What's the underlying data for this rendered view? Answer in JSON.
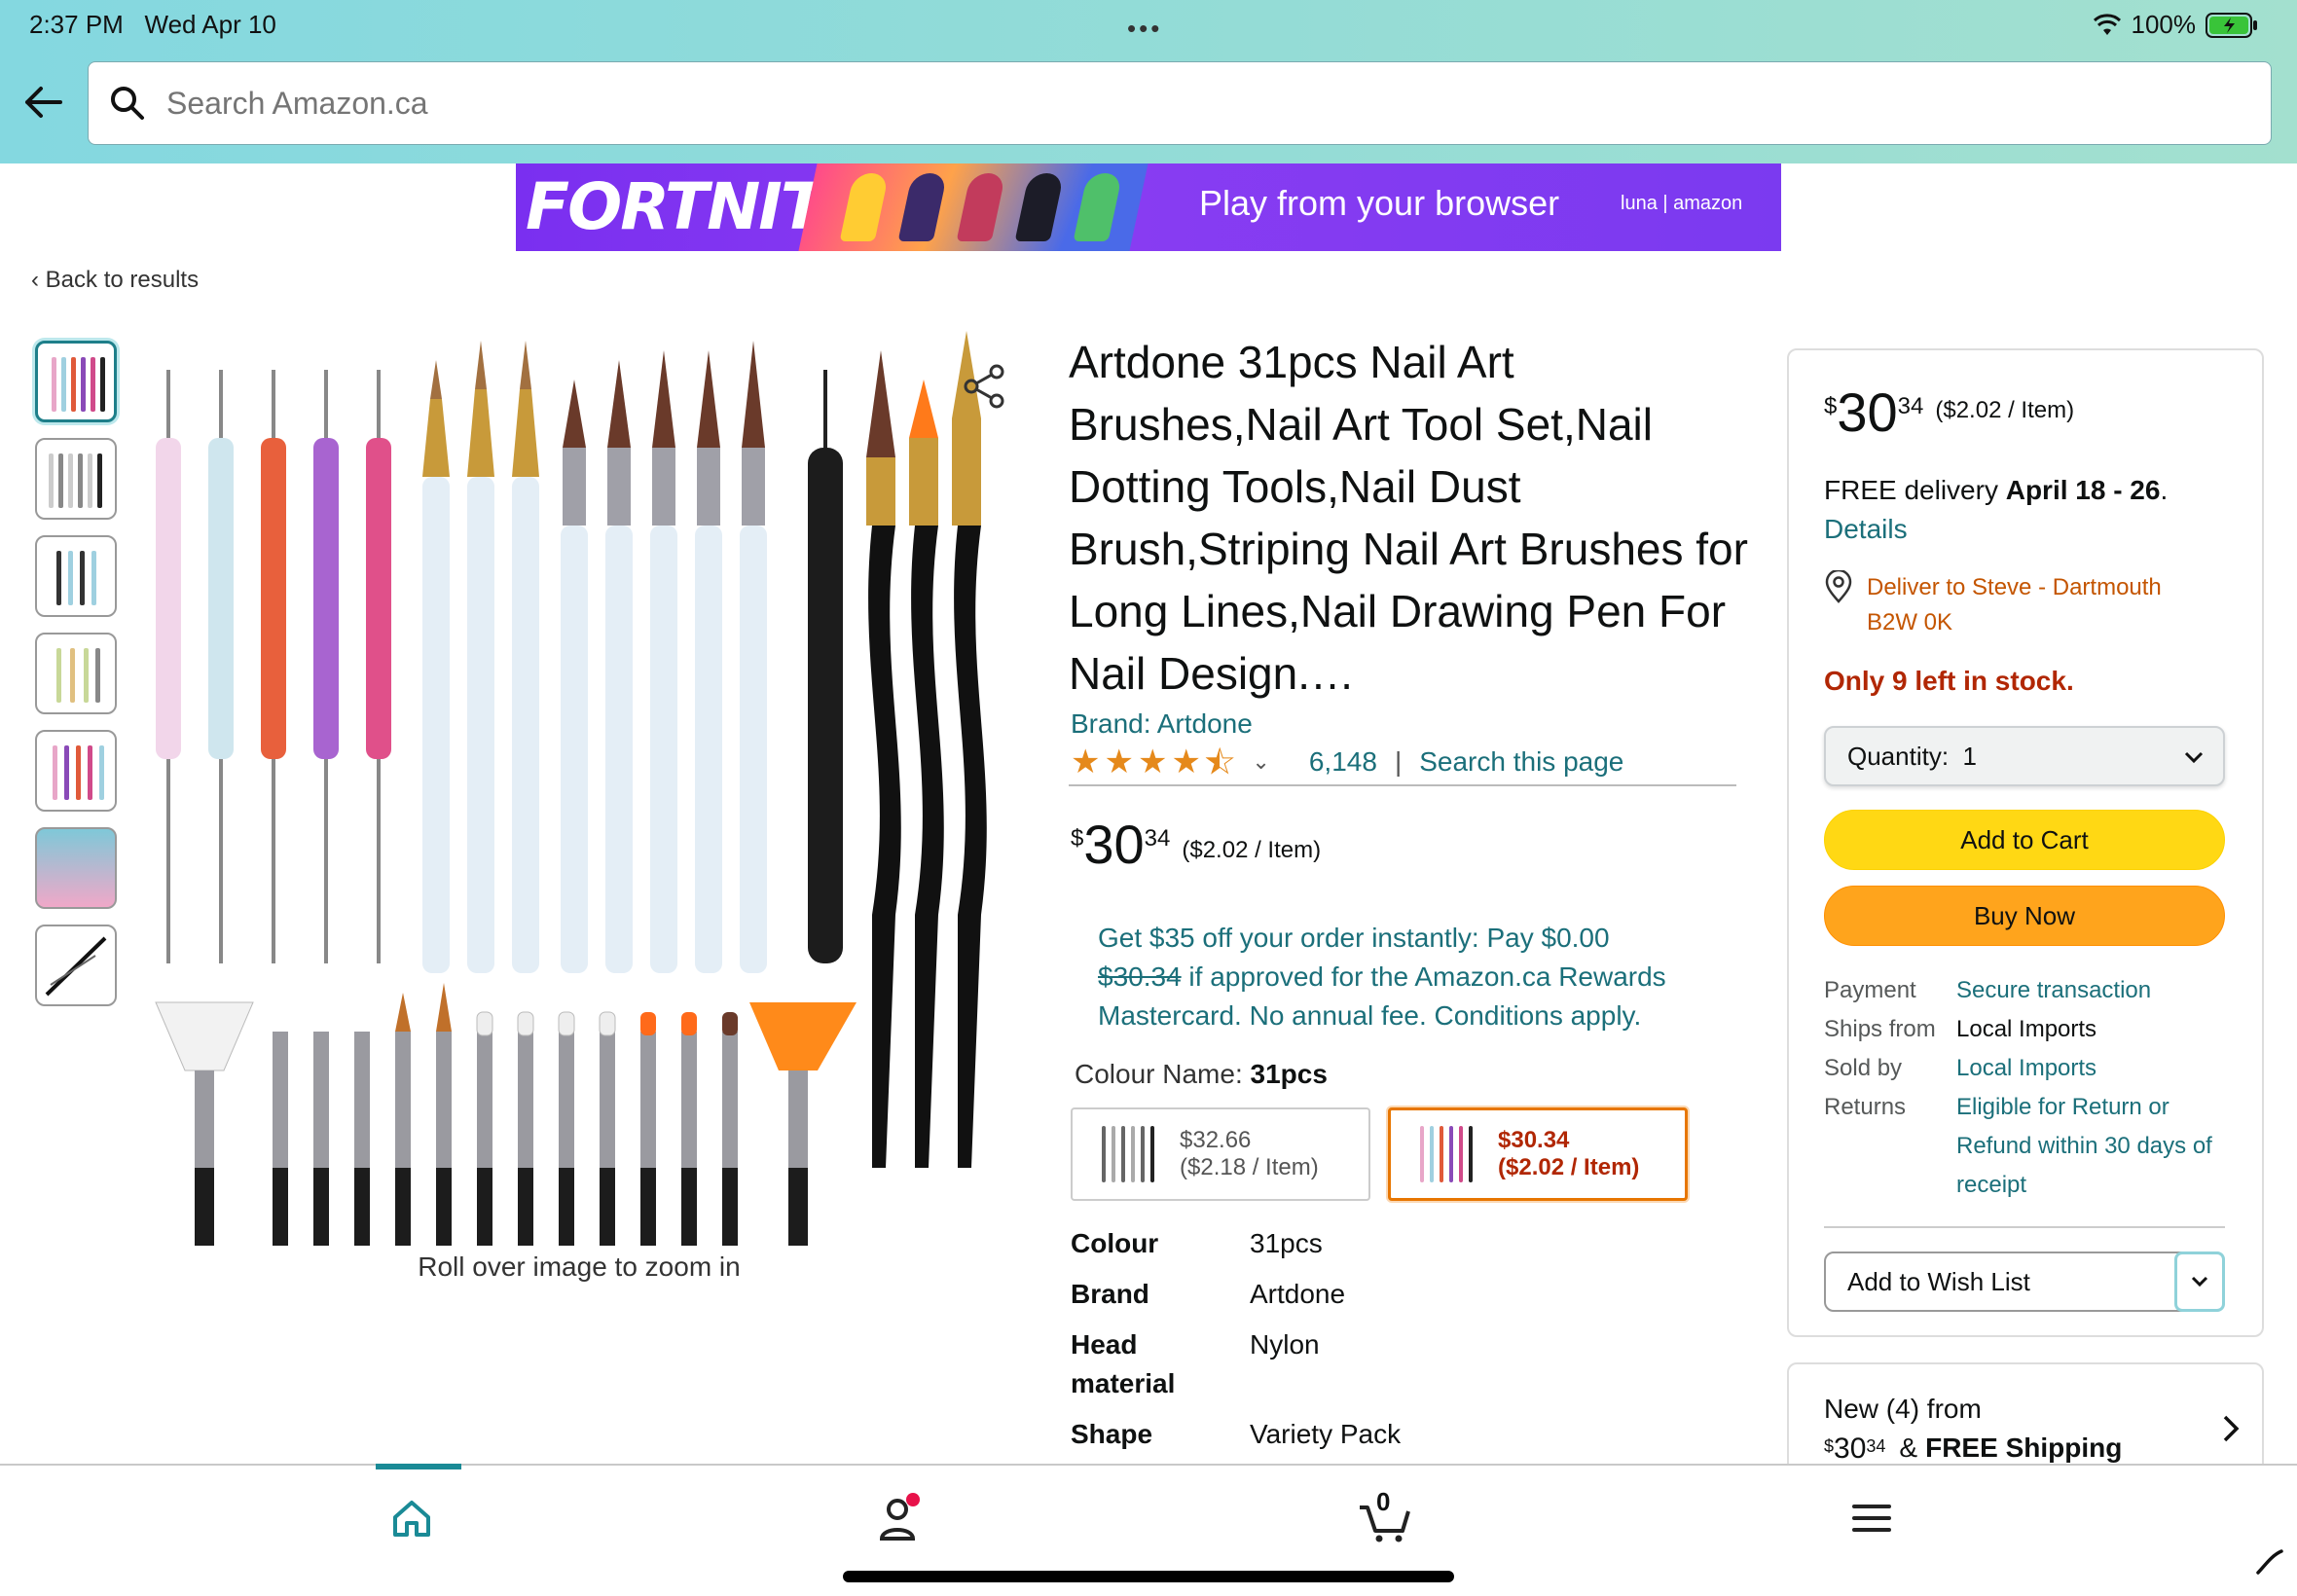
{
  "status_bar": {
    "time": "2:37 PM",
    "date": "Wed Apr 10",
    "battery": "100%",
    "icons": [
      "wifi-icon",
      "battery-icon"
    ]
  },
  "header": {
    "search_placeholder": "Search Amazon.ca",
    "icons": [
      "back-arrow-icon",
      "search-icon"
    ]
  },
  "banner": {
    "logo": "FORTNITE",
    "tagline": "Play from your browser",
    "brand": "luna | amazon"
  },
  "nav": {
    "back_to_results": "Back to results"
  },
  "gallery": {
    "thumbnail_count": 7,
    "selected_index": 0,
    "zoom_hint": "Roll over image to zoom in"
  },
  "product": {
    "title": "Artdone 31pcs Nail Art Brushes,Nail Art Tool Set,Nail Dotting Tools,Nail Dust Brush,Striping Nail Art Brushes for Long Lines,Nail Drawing Pen For Nail Design.…",
    "brand_link": "Brand: Artdone",
    "rating_stars": 4.5,
    "rating_count": "6,148",
    "rating_separator": "|",
    "search_page": "Search this page",
    "price": {
      "symbol": "$",
      "whole": "30",
      "fraction": "34",
      "unit": "($2.02 / Item)"
    },
    "promo": {
      "line": "Get $35 off your order instantly: Pay $0.00",
      "strike": "$30.34",
      "rest": "if approved for the Amazon.ca Rewards Mastercard. No annual fee. Conditions apply."
    },
    "colour": {
      "label": "Colour Name:",
      "value": "31pcs",
      "options": [
        {
          "price": "$32.66",
          "unit": "($2.18 / Item)",
          "selected": false
        },
        {
          "price": "$30.34",
          "unit": "($2.02 / Item)",
          "selected": true
        }
      ]
    },
    "specs": [
      {
        "key": "Colour",
        "value": "31pcs"
      },
      {
        "key": "Brand",
        "value": "Artdone"
      },
      {
        "key": "Head material",
        "value": "Nylon"
      },
      {
        "key": "Shape",
        "value": "Variety Pack"
      }
    ]
  },
  "buybox": {
    "price": {
      "symbol": "$",
      "whole": "30",
      "fraction": "34",
      "unit": "($2.02 / Item)"
    },
    "delivery_prefix": "FREE delivery",
    "delivery_dates": "April 18 - 26",
    "delivery_suffix": ".",
    "details": "Details",
    "deliver_to": "Deliver to Steve - Dartmouth B2W 0K",
    "stock": "Only 9 left in stock.",
    "quantity_label": "Quantity:",
    "quantity_value": "1",
    "add_to_cart": "Add to Cart",
    "buy_now": "Buy Now",
    "info": [
      {
        "key": "Payment",
        "value": "Secure transaction",
        "link": true
      },
      {
        "key": "Ships from",
        "value": "Local Imports",
        "link": false
      },
      {
        "key": "Sold by",
        "value": "Local Imports",
        "link": true
      },
      {
        "key": "Returns",
        "value": "Eligible for Return or Refund within 30 days of receipt",
        "link": true
      }
    ],
    "wish_list": "Add to Wish List"
  },
  "new_offers": {
    "line1": "New (4) from",
    "price_symbol": "$",
    "price_whole": "30",
    "price_fraction": "34",
    "shipping_prefix": "&",
    "shipping": "FREE Shipping"
  },
  "bottom_nav": {
    "items": [
      "home-icon",
      "account-icon",
      "cart-icon",
      "menu-icon"
    ],
    "cart_count": "0",
    "accent": "#1a8a96"
  },
  "colors": {
    "link": "#1b6f7a",
    "price_red": "#b12704",
    "cart_yellow": "#ffd814",
    "buy_orange": "#ffa41c",
    "location_orange": "#c45500"
  }
}
